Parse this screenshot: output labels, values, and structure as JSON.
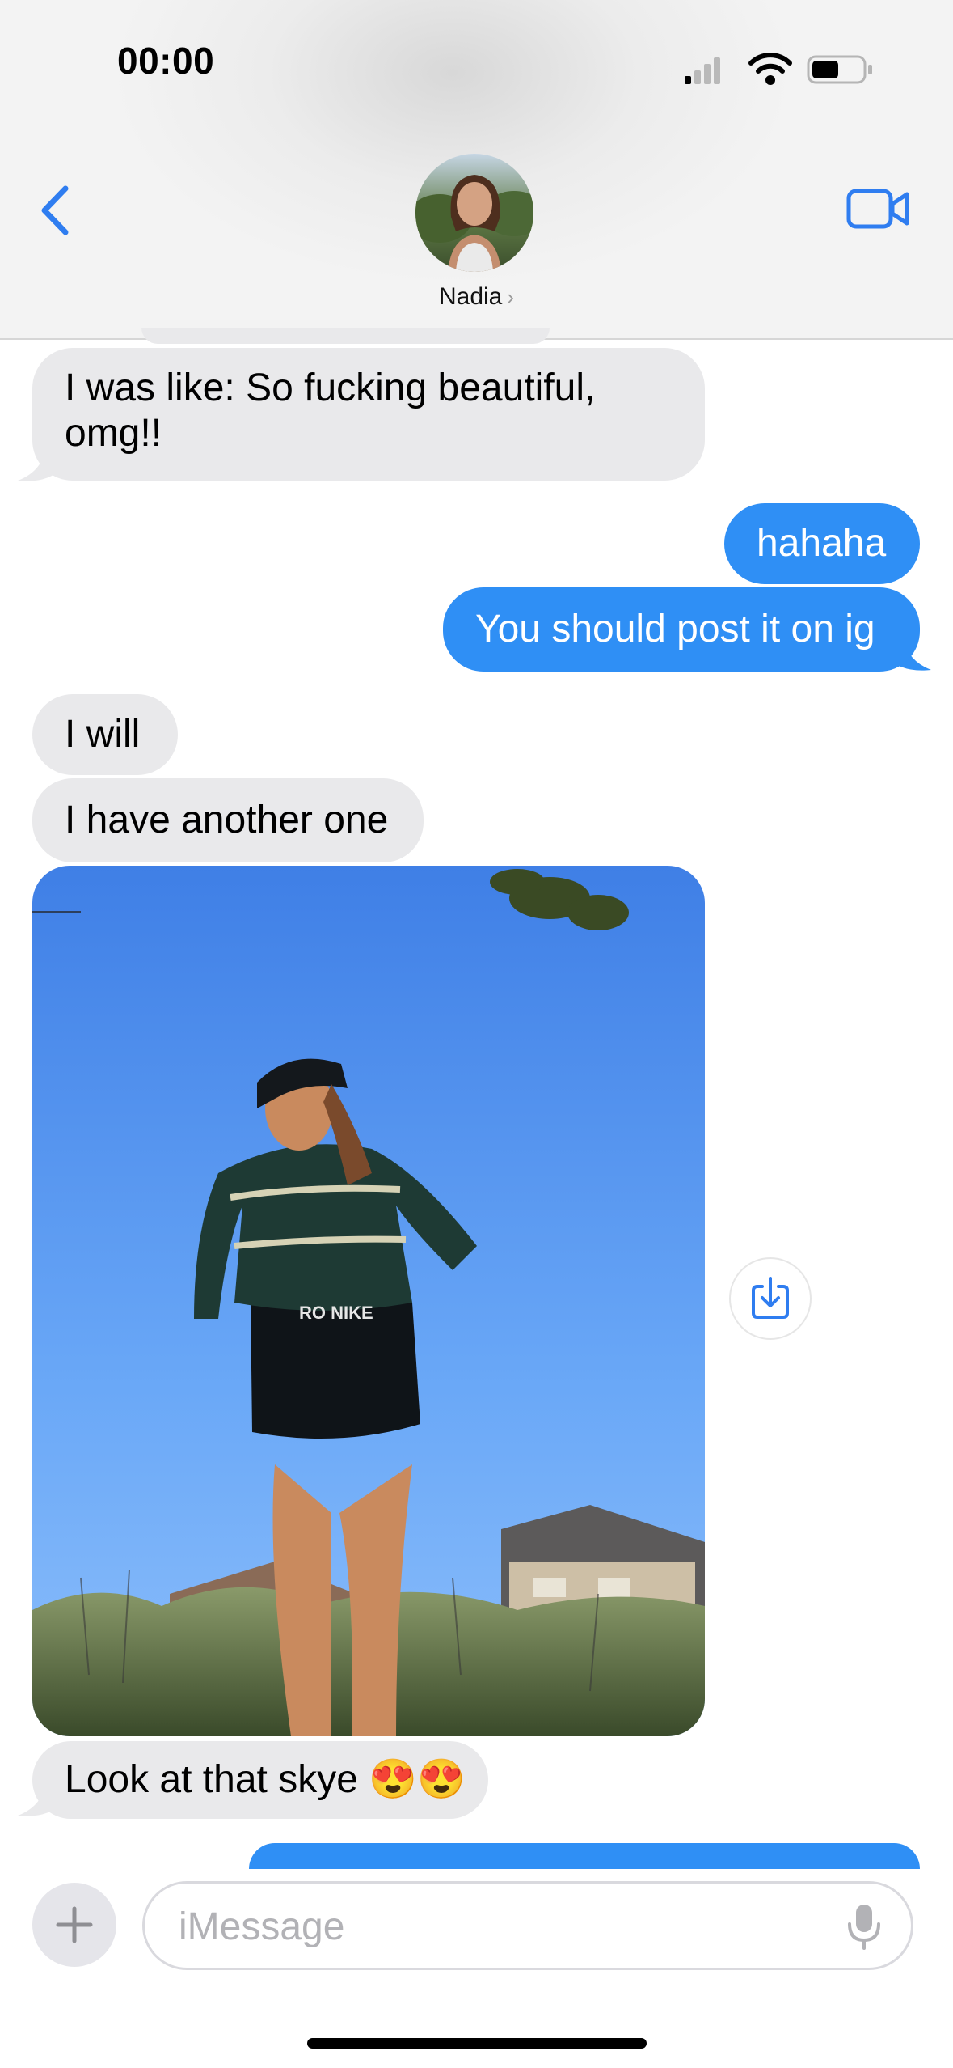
{
  "status_bar": {
    "time": "00:00",
    "battery_level": 0.5
  },
  "header": {
    "contact_name": "Nadia",
    "name_chevron": "›"
  },
  "messages": [
    {
      "from": "them",
      "text": "I was like: So fucking beautiful, omg!!"
    },
    {
      "from": "me",
      "text": "hahaha"
    },
    {
      "from": "me",
      "text": "You should post it on ig"
    },
    {
      "from": "them",
      "text": "I will"
    },
    {
      "from": "them",
      "text": "I have another one"
    },
    {
      "from": "them",
      "type": "photo"
    },
    {
      "from": "them",
      "text": "Look at that skye 😍😍"
    },
    {
      "from": "me",
      "text": ""
    }
  ],
  "input_bar": {
    "placeholder": "iMessage"
  },
  "icons": {
    "back": "chevron-left-icon",
    "video": "video-camera-icon",
    "save": "save-download-icon",
    "plus": "plus-icon",
    "mic": "microphone-icon"
  },
  "colors": {
    "accent": "#2f8ff5",
    "received_bubble": "#e9e9eb",
    "sent_bubble": "#2f8ff5"
  }
}
